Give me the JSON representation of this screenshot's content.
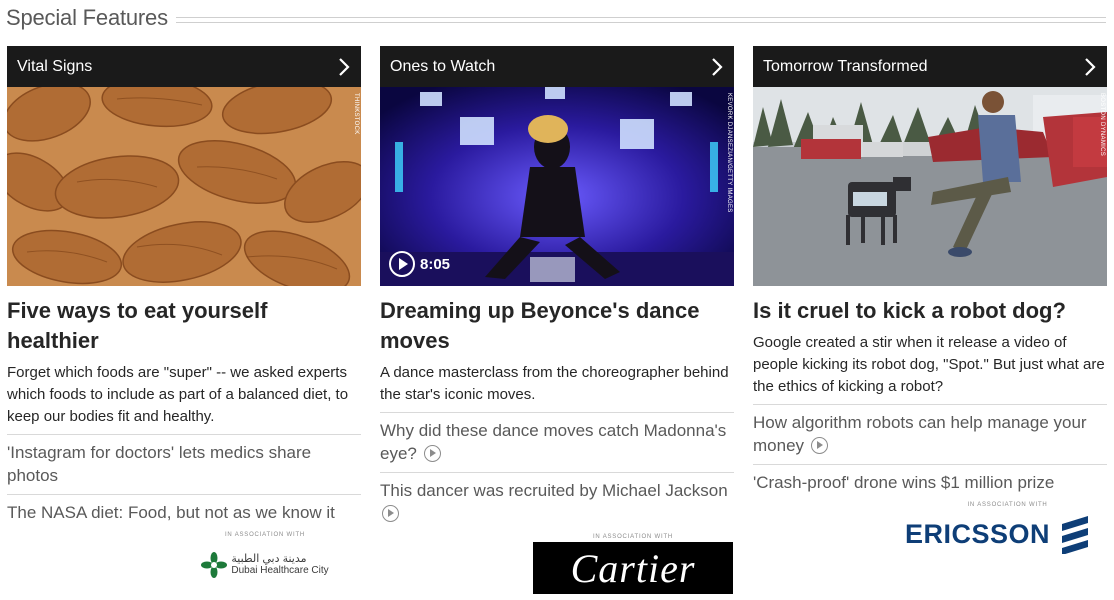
{
  "section": {
    "title": "Special Features"
  },
  "columns": [
    {
      "category": "Vital Signs",
      "image": {
        "alt": "almonds",
        "credit": "THINKSTOCK"
      },
      "headline": "Five ways to eat yourself healthier",
      "summary": "Forget which foods are \"super\" -- we asked experts which foods to include as part of a balanced diet, to keep our bodies fit and healthy.",
      "related": [
        {
          "text": "'Instagram for doctors' lets medics share photos",
          "video": false
        },
        {
          "text": "The NASA diet: Food, but not as we know it",
          "video": false
        }
      ],
      "sponsor": {
        "assoc_label": "IN ASSOCIATION WITH",
        "name_ar": "مدينة دبي الطبية",
        "name_en": "Dubai Healthcare City",
        "color": "#1d7a3a"
      }
    },
    {
      "category": "Ones to Watch",
      "image": {
        "alt": "performer on stage",
        "credit": "KEVORK DJANSEZIAN/GETTY IMAGES",
        "duration": "8:05"
      },
      "headline": "Dreaming up Beyonce's dance moves",
      "summary": "A dance masterclass from the choreographer behind the star's iconic moves.",
      "related": [
        {
          "text": "Why did these dance moves catch Madonna's eye?",
          "video": true
        },
        {
          "text": "This dancer was recruited by Michael Jackson",
          "video": true
        }
      ],
      "sponsor": {
        "assoc_label": "IN ASSOCIATION WITH",
        "name": "Cartier"
      }
    },
    {
      "category": "Tomorrow Transformed",
      "image": {
        "alt": "man kicking a robot dog",
        "credit": "BOSTON DYNAMICS"
      },
      "headline": "Is it cruel to kick a robot dog?",
      "summary": "Google created a stir when it release a video of people kicking its robot dog, \"Spot.\" But just what are the ethics of kicking a robot?",
      "related": [
        {
          "text": "How algorithm robots can help manage your money",
          "video": true
        },
        {
          "text": "'Crash-proof' drone wins $1 million prize",
          "video": false
        }
      ],
      "sponsor": {
        "assoc_label": "IN ASSOCIATION WITH",
        "name": "ERICSSON",
        "color": "#0e3e77"
      }
    }
  ]
}
